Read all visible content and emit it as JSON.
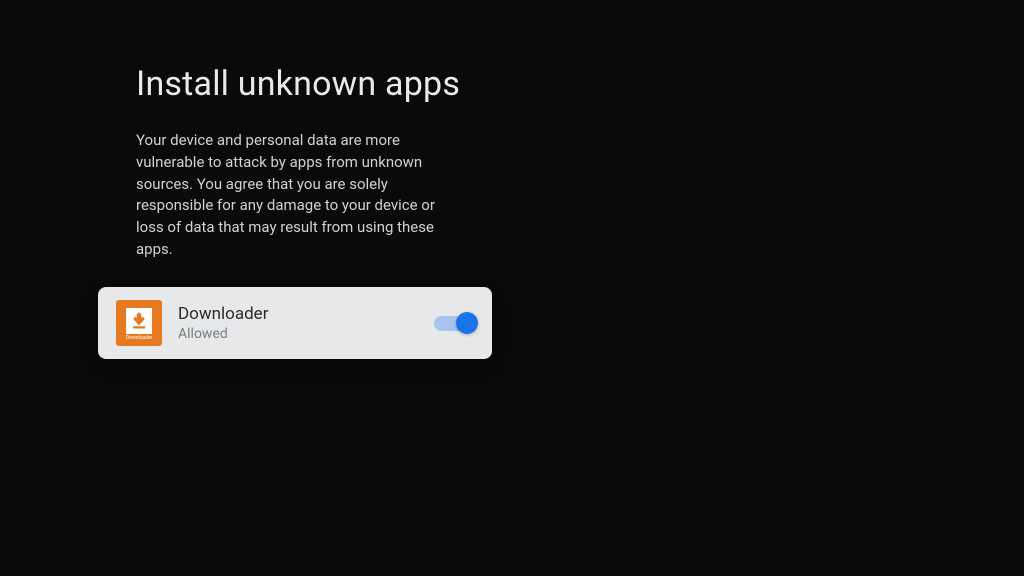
{
  "page": {
    "title": "Install unknown apps",
    "description": "Your device and personal data are more vulnerable to attack by apps from unknown sources. You agree that you are solely responsible for any damage to your device or loss of data that may result from using these apps."
  },
  "app": {
    "name": "Downloader",
    "status": "Allowed",
    "icon_label": "Downloader",
    "toggle_on": true
  },
  "colors": {
    "accent": "#1a73e8",
    "app_icon_bg": "#e77920"
  }
}
